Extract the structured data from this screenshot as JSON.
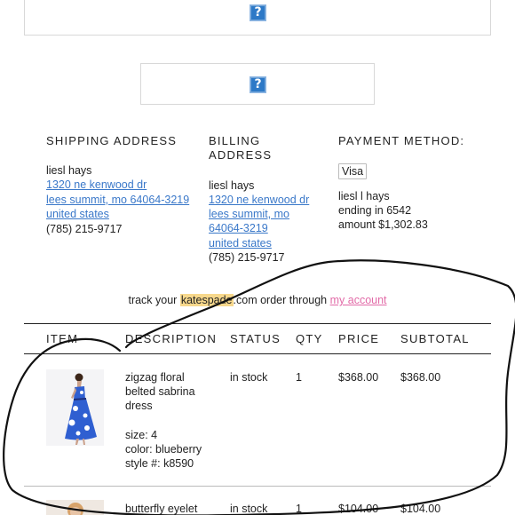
{
  "placeholder_images": [
    {
      "icon": "broken-image-icon",
      "glyph": "?"
    },
    {
      "icon": "broken-image-icon",
      "glyph": "?"
    }
  ],
  "shipping": {
    "heading": "SHIPPING ADDRESS",
    "name": "liesl hays",
    "street": "1320 ne kenwood dr",
    "city": "lees summit, mo 64064-3219",
    "country": "united states",
    "phone": "(785) 215-9717"
  },
  "billing": {
    "heading_line1": "BILLING",
    "heading_line2": "ADDRESS",
    "name": "liesl hays",
    "street": "1320 ne kenwood dr",
    "city": "lees summit, mo",
    "zip": "64064-3219",
    "country": "united states",
    "phone": "(785) 215-9717"
  },
  "payment": {
    "heading": "PAYMENT METHOD:",
    "card_type": "Visa",
    "name": "liesl l hays",
    "ending": "ending in 6542",
    "amount": "amount $1,302.83"
  },
  "track": {
    "prefix": "track your ",
    "brand": "katespade",
    "middle": ".com order through ",
    "link": "my account"
  },
  "table": {
    "headers": {
      "item": "ITEM",
      "description": "DESCRIPTION",
      "status": "STATUS",
      "qty": "QTY",
      "price": "PRICE",
      "subtotal": "SUBTOTAL"
    },
    "rows": [
      {
        "desc_line1": "zigzag floral",
        "desc_line2": "belted sabrina",
        "desc_line3": "dress",
        "size": "size: 4",
        "color": "color: blueberry",
        "style": "style #: k8590",
        "status": "in stock",
        "qty": "1",
        "price": "$368.00",
        "subtotal": "$368.00"
      },
      {
        "desc_line1": "butterfly eyelet",
        "status": "in stock",
        "qty": "1",
        "price": "$104.00",
        "subtotal": "$104.00"
      }
    ]
  },
  "colors": {
    "link": "#3a78c9",
    "account_link": "#e26aa7",
    "brand_highlight": "#f7d88c",
    "icon_blue": "#2d79c7",
    "annotation_ink": "#111111"
  }
}
